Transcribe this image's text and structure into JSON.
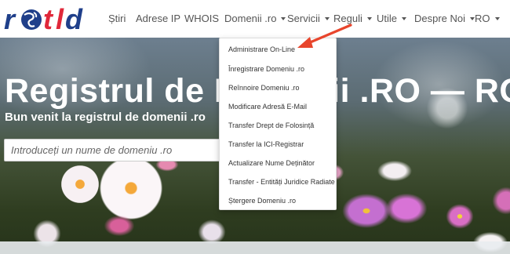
{
  "brand": {
    "logo_text": "rotld",
    "logo_colors": {
      "r": "#1f3f8a",
      "o": "#2b4a9a",
      "t": "#e0283a",
      "l": "#e0283a",
      "d": "#1f3f8a"
    }
  },
  "nav": {
    "items": [
      {
        "label": "Știri",
        "dropdown": false
      },
      {
        "label": "Adrese IP",
        "dropdown": false
      },
      {
        "label": "WHOIS",
        "dropdown": false
      },
      {
        "label": "Domenii .ro",
        "dropdown": true
      },
      {
        "label": "Servicii",
        "dropdown": true
      },
      {
        "label": "Reguli",
        "dropdown": true
      },
      {
        "label": "Utile",
        "dropdown": true
      },
      {
        "label": "Despre Noi",
        "dropdown": true
      },
      {
        "label": "RO",
        "dropdown": true
      }
    ]
  },
  "hero": {
    "title": "Registrul de Domenii .RO — ROTLD",
    "subtitle": "Bun venit la registrul de domenii .ro",
    "search_placeholder": "Introduceți un nume de domeniu .ro"
  },
  "services_menu": {
    "items": [
      "Administrare On-Line",
      "Înregistrare Domeniu .ro",
      "Reînnoire Domeniu .ro",
      "Modificare Adresă E-Mail",
      "Transfer Drept de Folosință",
      "Transfer la ICI-Registrar",
      "Actualizare Nume Deținător",
      "Transfer - Entități Juridice Radiate",
      "Ștergere Domeniu .ro"
    ]
  },
  "annotation": {
    "arrow_color": "#e8452c"
  },
  "colors": {
    "nav_text": "#555555",
    "hero_text": "#ffffff"
  }
}
